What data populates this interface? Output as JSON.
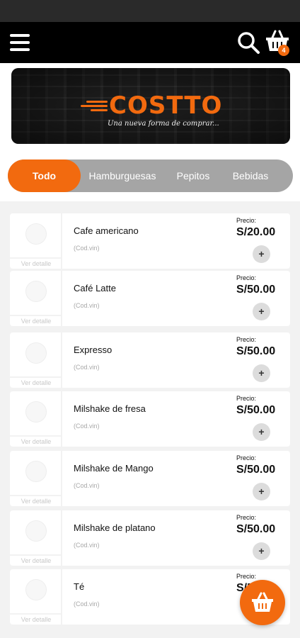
{
  "header": {
    "menu_icon": "hamburger-menu-icon",
    "search_icon": "search-icon",
    "cart_icon": "shopping-basket-icon",
    "cart_count": "4"
  },
  "banner": {
    "brand": "COSTTO",
    "tagline": "Una nueva forma de comprar..."
  },
  "tabs": [
    {
      "label": "Todo",
      "active": true
    },
    {
      "label": "Hamburguesas",
      "active": false
    },
    {
      "label": "Pepitos",
      "active": false
    },
    {
      "label": "Bebidas",
      "active": false
    }
  ],
  "products": [
    {
      "name": "Cafe americano",
      "code": "(Cod.vin)",
      "price_label": "Precio:",
      "price": "S/20.00",
      "detail_link": "Ver detalle"
    },
    {
      "name": "Café Latte",
      "code": "(Cod.vin)",
      "price_label": "Precio:",
      "price": "S/50.00",
      "detail_link": "Ver detalle"
    },
    {
      "name": "Expresso",
      "code": "(Cod.vin)",
      "price_label": "Precio:",
      "price": "S/50.00",
      "detail_link": "Ver detalle"
    },
    {
      "name": "Milshake de fresa",
      "code": "(Cod.vin)",
      "price_label": "Precio:",
      "price": "S/50.00",
      "detail_link": "Ver detalle"
    },
    {
      "name": "Milshake de Mango",
      "code": "(Cod.vin)",
      "price_label": "Precio:",
      "price": "S/50.00",
      "detail_link": "Ver detalle"
    },
    {
      "name": "Milshake de platano",
      "code": "(Cod.vin)",
      "price_label": "Precio:",
      "price": "S/50.00",
      "detail_link": "Ver detalle"
    },
    {
      "name": "Té",
      "code": "(Cod.vin)",
      "price_label": "Precio:",
      "price": "S/50.00",
      "detail_link": "Ver detalle"
    }
  ],
  "add_button_label": "+",
  "fab": {
    "icon": "shopping-basket-icon"
  },
  "colors": {
    "accent": "#f26a0f",
    "header": "#000000",
    "tabs_bg": "#a5a5a5"
  }
}
